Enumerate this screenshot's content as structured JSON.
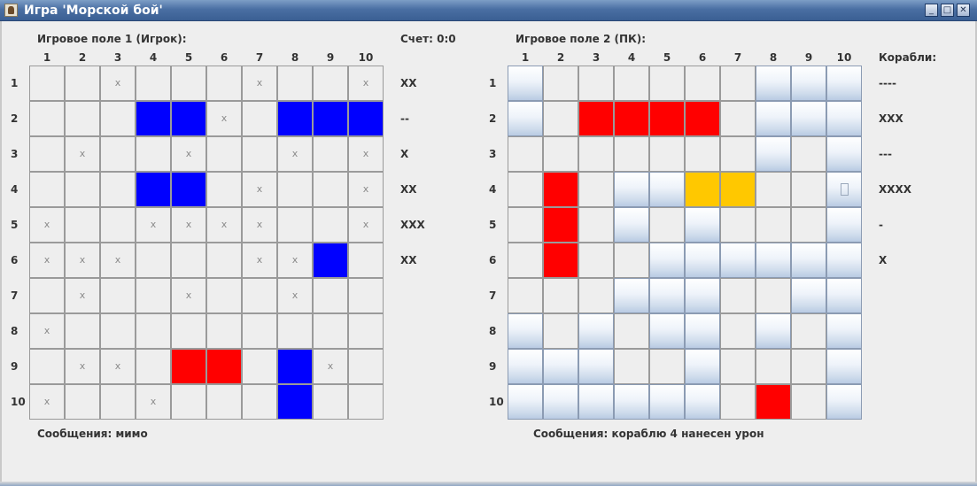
{
  "window": {
    "title": "Игра 'Морской бой'",
    "buttons": [
      "_",
      "□",
      "✕"
    ]
  },
  "player_board": {
    "title": "Игровое поле 1 (Игрок):",
    "cols": [
      "1",
      "2",
      "3",
      "4",
      "5",
      "6",
      "7",
      "8",
      "9",
      "10"
    ],
    "rows": [
      "1",
      "2",
      "3",
      "4",
      "5",
      "6",
      "7",
      "8",
      "9",
      "10"
    ],
    "cells": [
      [
        "",
        "",
        "x",
        "",
        "",
        "",
        "x",
        "",
        "",
        "x"
      ],
      [
        "",
        "",
        "",
        "B",
        "B",
        "x",
        "",
        "B",
        "B",
        "B"
      ],
      [
        "",
        "x",
        "",
        "",
        "x",
        "",
        "",
        "x",
        "",
        "x"
      ],
      [
        "",
        "",
        "",
        "B",
        "B",
        "",
        "x",
        "",
        "",
        "x"
      ],
      [
        "x",
        "",
        "",
        "x",
        "x",
        "x",
        "x",
        "",
        "",
        "x"
      ],
      [
        "x",
        "x",
        "x",
        "",
        "",
        "",
        "x",
        "x",
        "B",
        ""
      ],
      [
        "",
        "x",
        "",
        "",
        "x",
        "",
        "",
        "x",
        "",
        ""
      ],
      [
        "x",
        "",
        "",
        "",
        "",
        "",
        "",
        "",
        "",
        ""
      ],
      [
        "",
        "x",
        "x",
        "",
        "R",
        "R",
        "",
        "B",
        "x",
        ""
      ],
      [
        "x",
        "",
        "",
        "x",
        "",
        "",
        "",
        "B",
        "",
        ""
      ]
    ],
    "ships": [
      "XX",
      "--",
      "X",
      "XX",
      "XXX",
      "XX"
    ],
    "message": "Сообщения: мимо"
  },
  "score": "Счет: 0:0",
  "pc_board": {
    "title": "Игровое поле 2 (ПК):",
    "ships_title": "Корабли:",
    "cols": [
      "1",
      "2",
      "3",
      "4",
      "5",
      "6",
      "7",
      "8",
      "9",
      "10"
    ],
    "rows": [
      "1",
      "2",
      "3",
      "4",
      "5",
      "6",
      "7",
      "8",
      "9",
      "10"
    ],
    "cells": [
      [
        "b",
        "",
        "",
        "",
        "",
        "",
        "",
        "b",
        "b",
        "b"
      ],
      [
        "b",
        "",
        "R",
        "R",
        "R",
        "R",
        "",
        "b",
        "b",
        "b"
      ],
      [
        "",
        "",
        "",
        "",
        "",
        "",
        "",
        "b",
        "",
        "b"
      ],
      [
        "",
        "R",
        "",
        "b",
        "b",
        "O",
        "O",
        "",
        "",
        "f"
      ],
      [
        "",
        "R",
        "",
        "b",
        "",
        "b",
        "",
        "",
        "",
        "b"
      ],
      [
        "",
        "R",
        "",
        "",
        "b",
        "b",
        "b",
        "b",
        "b",
        "b"
      ],
      [
        "",
        "",
        "",
        "b",
        "b",
        "b",
        "",
        "",
        "b",
        "b"
      ],
      [
        "b",
        "",
        "b",
        "",
        "b",
        "b",
        "",
        "b",
        "",
        "b"
      ],
      [
        "b",
        "b",
        "b",
        "",
        "",
        "b",
        "",
        "",
        "",
        "b"
      ],
      [
        "b",
        "b",
        "b",
        "b",
        "b",
        "b",
        "",
        "R",
        "",
        "b"
      ]
    ],
    "ships": [
      "----",
      "XXX",
      "---",
      "XXXX",
      "-",
      "X"
    ],
    "message": "Сообщения: кораблю 4 нанесен урон"
  }
}
